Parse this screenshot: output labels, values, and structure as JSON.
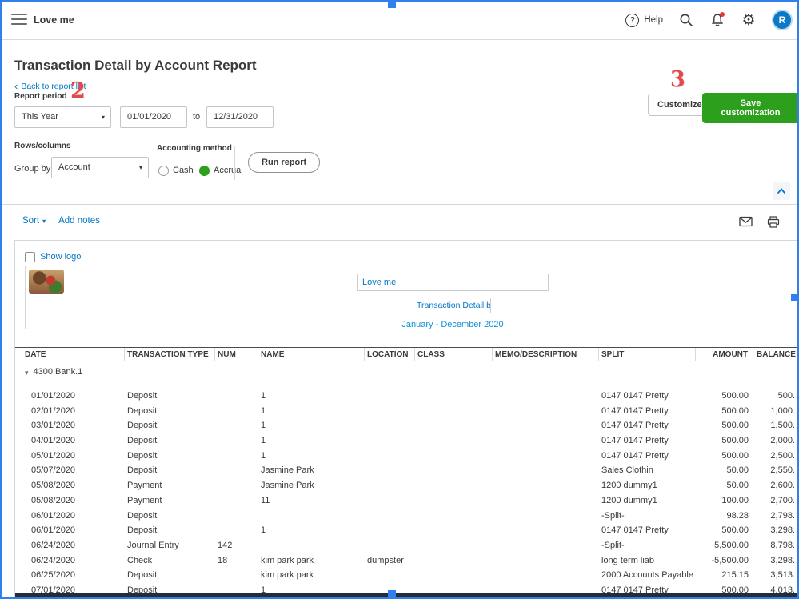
{
  "topbar": {
    "company": "Love me",
    "help_label": "Help",
    "avatar_initial": "R"
  },
  "page": {
    "title": "Transaction Detail by Account Report",
    "back_link": "Back to report list",
    "report_period_label": "Report period",
    "period_value": "This Year",
    "date_from": "01/01/2020",
    "to_label": "to",
    "date_to": "12/31/2020",
    "rows_columns_label": "Rows/columns",
    "group_by_label": "Group by",
    "group_by_value": "Account",
    "accounting_method_label": "Accounting method",
    "cash_label": "Cash",
    "accrual_label": "Accrual",
    "run_report_label": "Run report",
    "customize_label": "Customize",
    "save_customization_label": "Save customization"
  },
  "annotations": {
    "step2": "2",
    "step3": "3"
  },
  "toolbar": {
    "sort_label": "Sort",
    "add_notes_label": "Add notes"
  },
  "report_header": {
    "show_logo_label": "Show logo",
    "company_name": "Love me",
    "title_field": "Transaction Detail by Ac",
    "period_text": "January - December 2020"
  },
  "table": {
    "columns": [
      "DATE",
      "TRANSACTION TYPE",
      "NUM",
      "NAME",
      "LOCATION",
      "CLASS",
      "MEMO/DESCRIPTION",
      "SPLIT",
      "AMOUNT",
      "BALANCE"
    ],
    "group_label": "4300 Bank.1",
    "rows": [
      [
        "01/01/2020",
        "Deposit",
        "",
        "1",
        "",
        "",
        "",
        "0147 0147 Pretty",
        "500.00",
        "500."
      ],
      [
        "02/01/2020",
        "Deposit",
        "",
        "1",
        "",
        "",
        "",
        "0147 0147 Pretty",
        "500.00",
        "1,000."
      ],
      [
        "03/01/2020",
        "Deposit",
        "",
        "1",
        "",
        "",
        "",
        "0147 0147 Pretty",
        "500.00",
        "1,500."
      ],
      [
        "04/01/2020",
        "Deposit",
        "",
        "1",
        "",
        "",
        "",
        "0147 0147 Pretty",
        "500.00",
        "2,000."
      ],
      [
        "05/01/2020",
        "Deposit",
        "",
        "1",
        "",
        "",
        "",
        "0147 0147 Pretty",
        "500.00",
        "2,500."
      ],
      [
        "05/07/2020",
        "Deposit",
        "",
        "Jasmine Park",
        "",
        "",
        "",
        "Sales Clothin",
        "50.00",
        "2,550."
      ],
      [
        "05/08/2020",
        "Payment",
        "",
        "Jasmine Park",
        "",
        "",
        "",
        "1200 dummy1",
        "50.00",
        "2,600."
      ],
      [
        "05/08/2020",
        "Payment",
        "",
        "11",
        "",
        "",
        "",
        "1200 dummy1",
        "100.00",
        "2,700."
      ],
      [
        "06/01/2020",
        "Deposit",
        "",
        "",
        "",
        "",
        "",
        "-Split-",
        "98.28",
        "2,798."
      ],
      [
        "06/01/2020",
        "Deposit",
        "",
        "1",
        "",
        "",
        "",
        "0147 0147 Pretty",
        "500.00",
        "3,298."
      ],
      [
        "06/24/2020",
        "Journal Entry",
        "142",
        "",
        "",
        "",
        "",
        "-Split-",
        "5,500.00",
        "8,798."
      ],
      [
        "06/24/2020",
        "Check",
        "18",
        "kim park park",
        "dumpster",
        "",
        "",
        "long term liab",
        "-5,500.00",
        "3,298."
      ],
      [
        "06/25/2020",
        "Deposit",
        "",
        "kim park park",
        "",
        "",
        "",
        "2000 Accounts Payable",
        "215.15",
        "3,513."
      ],
      [
        "07/01/2020",
        "Deposit",
        "",
        "1",
        "",
        "",
        "",
        "0147 0147 Pretty",
        "500.00",
        "4,013."
      ]
    ]
  },
  "colors": {
    "accent_green": "#2ca01c",
    "link_blue": "#0077c5",
    "annotation_red": "#e14b4b",
    "selection_blue": "#2f80ed"
  }
}
